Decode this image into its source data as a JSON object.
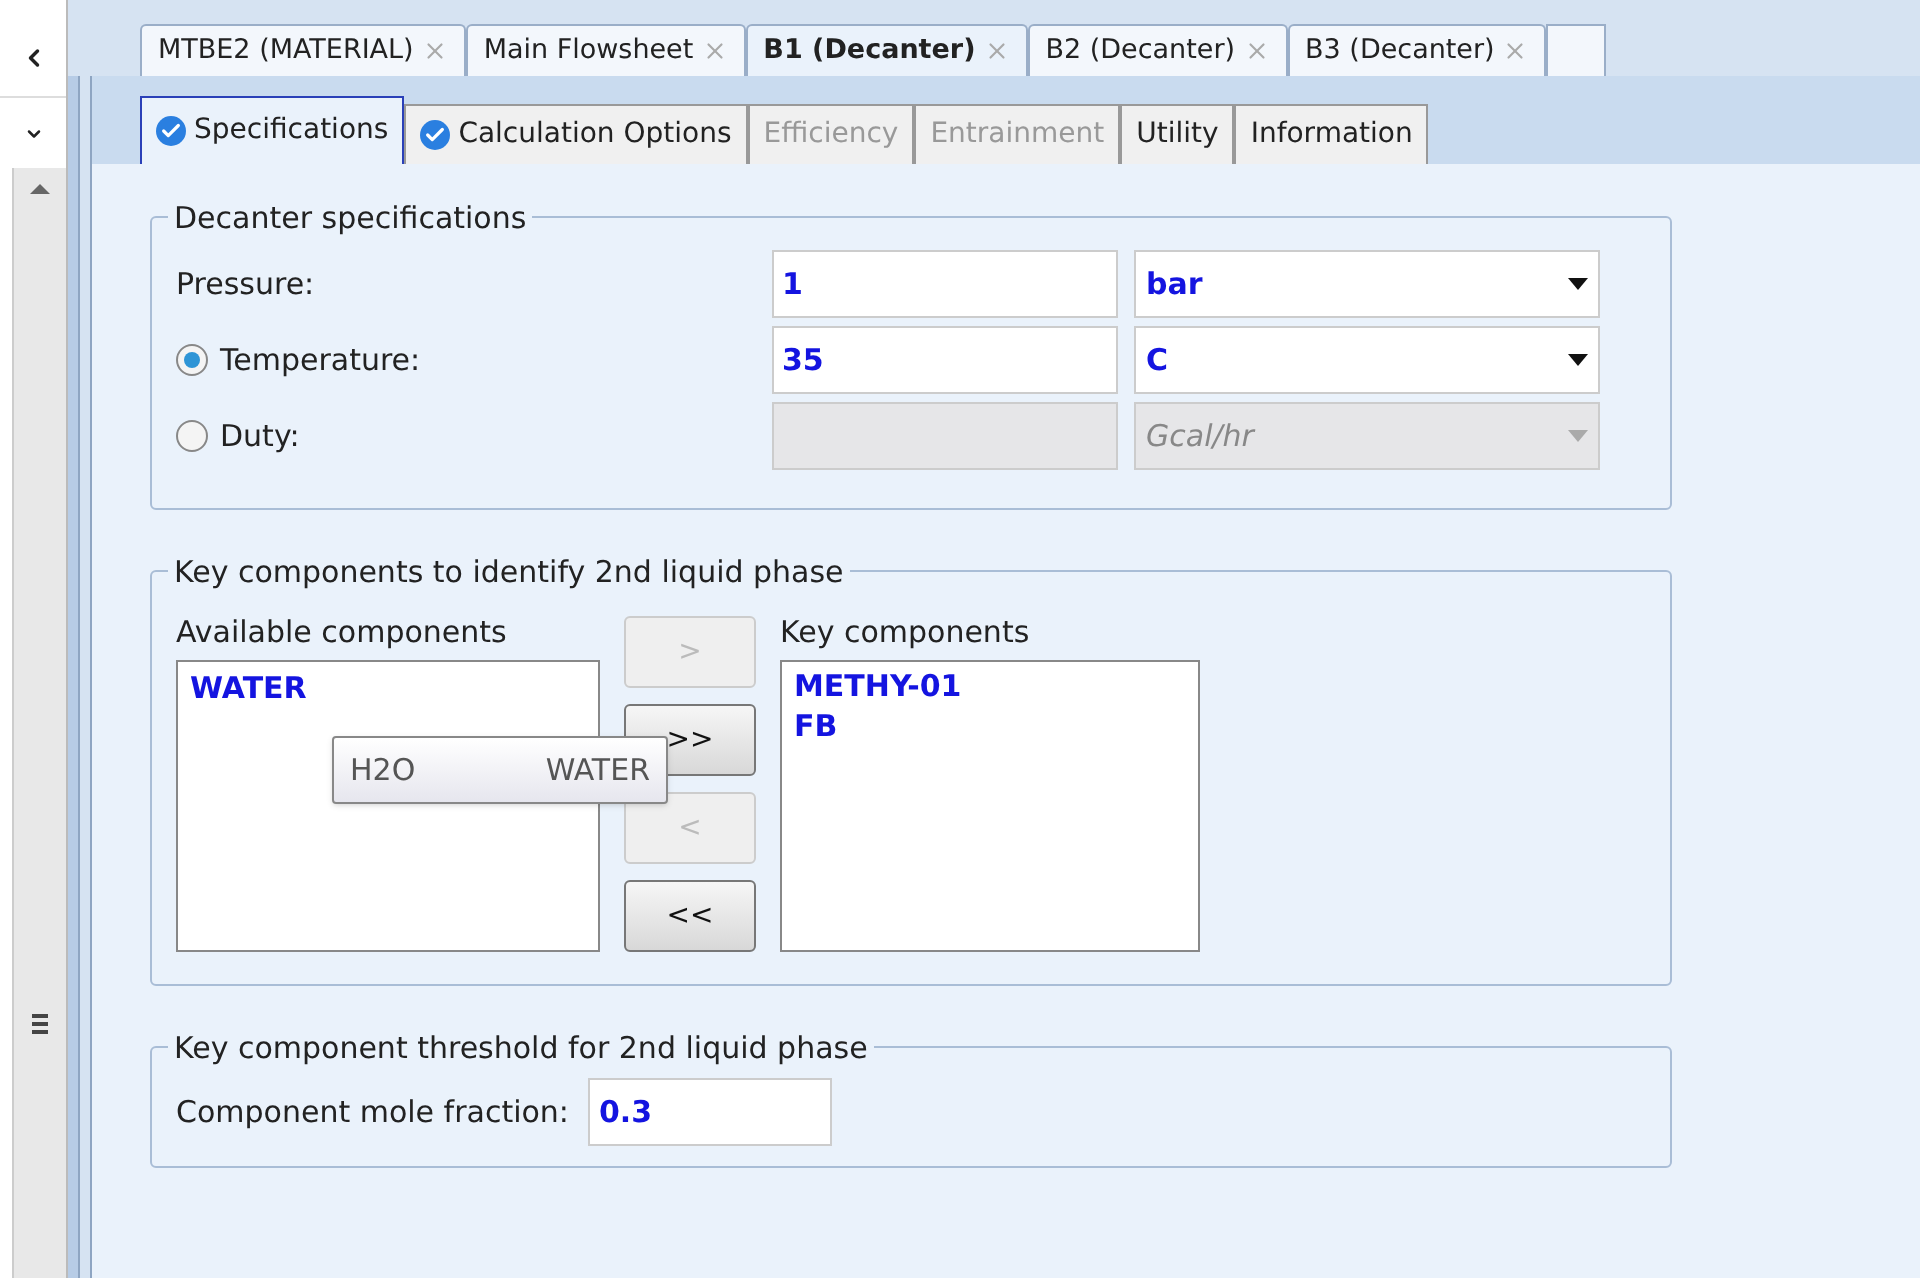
{
  "doc_tabs": [
    {
      "label": "MTBE2 (MATERIAL)",
      "selected": false
    },
    {
      "label": "Main Flowsheet",
      "selected": false
    },
    {
      "label": "B1 (Decanter)",
      "selected": true
    },
    {
      "label": "B2 (Decanter)",
      "selected": false
    },
    {
      "label": "B3 (Decanter)",
      "selected": false
    }
  ],
  "form_tabs": [
    {
      "label": "Specifications",
      "selected": true,
      "complete": true,
      "disabled": false
    },
    {
      "label": "Calculation Options",
      "selected": false,
      "complete": true,
      "disabled": false
    },
    {
      "label": "Efficiency",
      "selected": false,
      "complete": false,
      "disabled": true
    },
    {
      "label": "Entrainment",
      "selected": false,
      "complete": false,
      "disabled": true
    },
    {
      "label": "Utility",
      "selected": false,
      "complete": false,
      "disabled": false
    },
    {
      "label": "Information",
      "selected": false,
      "complete": false,
      "disabled": false
    }
  ],
  "decanter_specifications": {
    "title": "Decanter specifications",
    "rows": [
      {
        "kind": "plain",
        "label": "Pressure:",
        "value": "1",
        "unit": "bar",
        "disabled": false
      },
      {
        "kind": "radio",
        "label": "Temperature:",
        "selected": true,
        "value": "35",
        "unit": "C",
        "disabled": false
      },
      {
        "kind": "radio",
        "label": "Duty:",
        "selected": false,
        "unit": "Gcal/hr",
        "disabled": true
      }
    ]
  },
  "key_components": {
    "title": "Key components to identify 2nd liquid phase",
    "available_label": "Available components",
    "available": [
      "WATER"
    ],
    "key_label": "Key components",
    "keys": [
      "METHY-01",
      "FB"
    ],
    "buttons": [
      {
        "label": ">",
        "disabled": true
      },
      {
        "label": ">>",
        "disabled": false
      },
      {
        "label": "<",
        "disabled": true
      },
      {
        "label": "<<",
        "disabled": false
      }
    ],
    "tooltip": {
      "formula": "H2O",
      "name": "WATER"
    }
  },
  "threshold": {
    "title": "Key component threshold for 2nd liquid phase",
    "label": "Component mole fraction:",
    "value": "0.3"
  }
}
